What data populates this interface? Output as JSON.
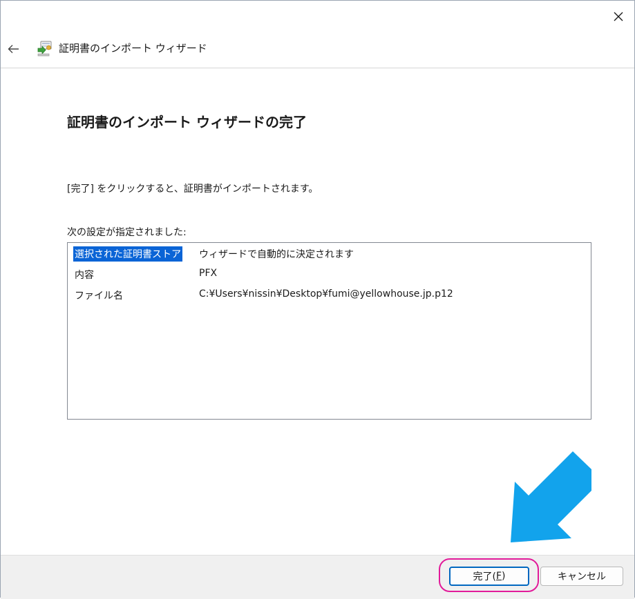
{
  "window": {
    "close_label": "Close"
  },
  "nav": {
    "title": "証明書のインポート ウィザード"
  },
  "main": {
    "title": "証明書のインポート ウィザードの完了",
    "instruction": "[完了] をクリックすると、証明書がインポートされます。",
    "settings_label": "次の設定が指定されました:",
    "settings": [
      {
        "key": "選択された証明書ストア",
        "value": "ウィザードで自動的に決定されます"
      },
      {
        "key": "内容",
        "value": "PFX"
      },
      {
        "key": "ファイル名",
        "value": "C:¥Users¥nissin¥Desktop¥fumi@yellowhouse.jp.p12"
      }
    ]
  },
  "footer": {
    "finish_label": "完了(",
    "finish_accel": "F",
    "finish_close": ")",
    "cancel_label": "キャンセル"
  },
  "colors": {
    "selection": "#0a64d6",
    "highlight_ring": "#e21a99",
    "callout_arrow": "#12a3ec",
    "accent": "#0067c0"
  },
  "icons": {
    "close": "close-icon",
    "back": "back-arrow-icon",
    "wizard": "certificate-wizard-icon",
    "callout": "callout-arrow-icon"
  }
}
